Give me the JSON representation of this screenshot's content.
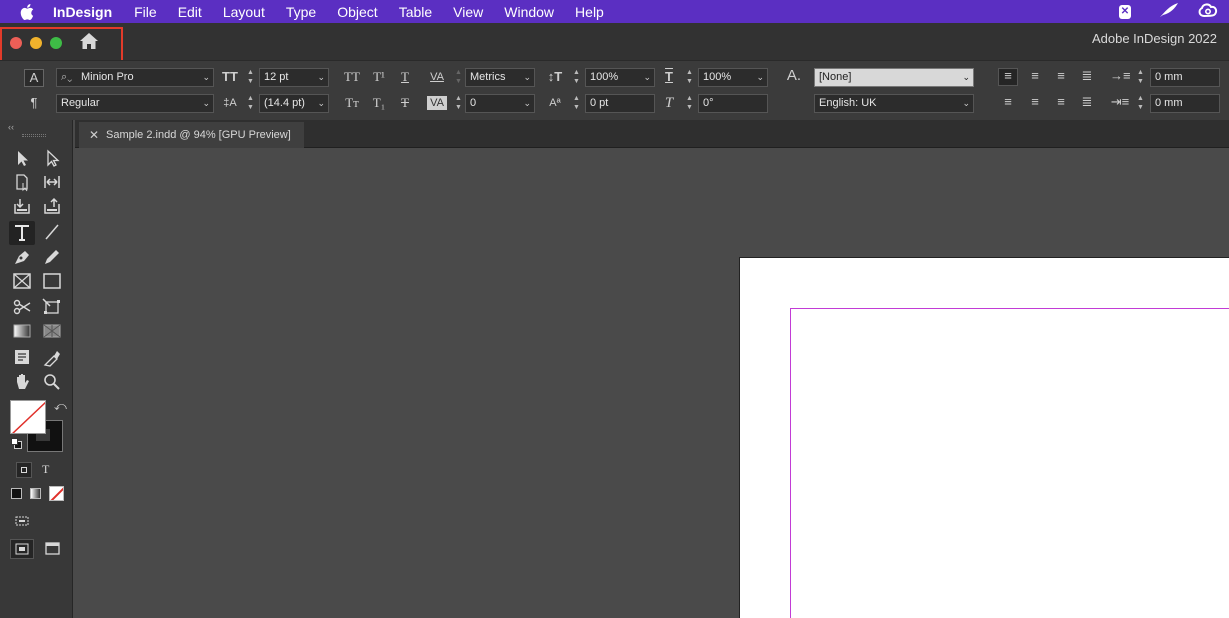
{
  "menubar": {
    "app_name": "InDesign",
    "items": [
      "File",
      "Edit",
      "Layout",
      "Type",
      "Object",
      "Table",
      "View",
      "Window",
      "Help"
    ]
  },
  "titlebar": {
    "title": "Adobe InDesign 2022"
  },
  "control_panel": {
    "font_family": "Minion Pro",
    "font_style": "Regular",
    "font_size": "12 pt",
    "leading": "(14.4 pt)",
    "kerning": "Metrics",
    "tracking": "0",
    "vertical_scale": "100%",
    "horizontal_scale": "100%",
    "baseline_shift": "0 pt",
    "skew": "0°",
    "character_style": "[None]",
    "language": "English: UK",
    "left_indent": "0 mm",
    "right_indent": "0 mm"
  },
  "document_tab": {
    "title": "Sample 2.indd @ 94% [GPU Preview]"
  },
  "colors": {
    "menubar": "#5b2fc2",
    "highlight": "#e23b2a",
    "margin_guide": "#c23bd6"
  }
}
